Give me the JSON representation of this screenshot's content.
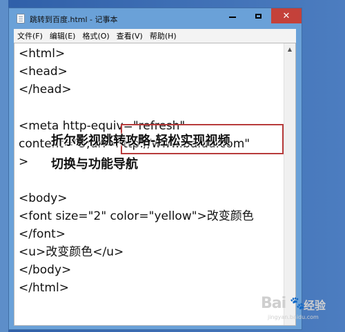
{
  "window": {
    "title": "跳转到百度.html - 记事本",
    "menu": [
      "文件(F)",
      "编辑(E)",
      "格式(O)",
      "查看(V)",
      "帮助(H)"
    ]
  },
  "editor": {
    "lines": [
      "<html>",
      "<head>",
      "</head>",
      "",
      "<meta http-equiv=\"refresh\"",
      "content=\"5;url=http://www.baidu.com\"",
      ">",
      "",
      "<body>",
      "<font size=\"2\" color=\"yellow\">改变颜色",
      "</font>",
      "<u>改变颜色</u>",
      "</body>",
      "</html>"
    ]
  },
  "overlay": {
    "line1": "折尔影视跳转攻略-轻松实现视频",
    "line2": "切换与功能导航"
  },
  "watermark": {
    "logo": "Bai",
    "paw": "🐾",
    "text": "经验",
    "sub": "jingyan.baidu.com"
  },
  "colors": {
    "titlebar": "#6aa1d8",
    "close": "#c4413a",
    "highlight_border": "#b73b3b"
  }
}
